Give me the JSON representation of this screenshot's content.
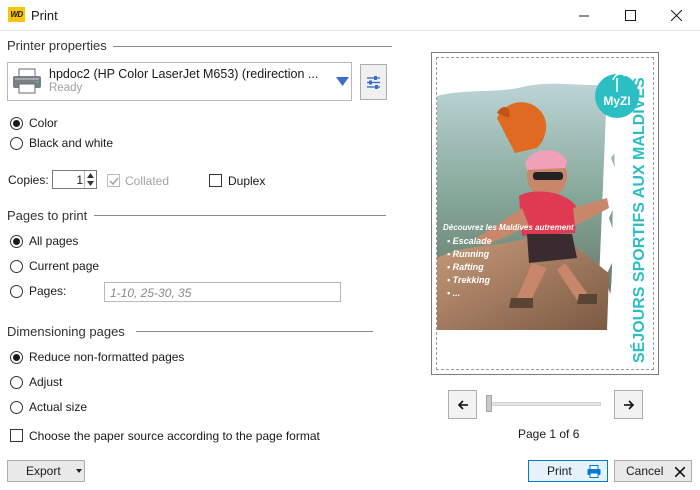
{
  "window": {
    "title": "Print",
    "logo_text": "WD"
  },
  "printer_properties": {
    "header": "Printer properties",
    "printer_name": "hpdoc2 (HP Color LaserJet M653) (redirection ...",
    "printer_status": "Ready"
  },
  "color_options": {
    "color_label": "Color",
    "bw_label": "Black and white",
    "selected": "Color"
  },
  "copies": {
    "label": "Copies:",
    "value": "1",
    "collated_label": "Collated",
    "duplex_label": "Duplex"
  },
  "pages_to_print": {
    "header": "Pages to print",
    "all_label": "All pages",
    "current_label": "Current page",
    "pages_label": "Pages:",
    "pages_placeholder": "1-10, 25-30, 35",
    "selected": "All pages"
  },
  "dimensioning": {
    "header": "Dimensioning pages",
    "reduce_label": "Reduce non-formatted pages",
    "adjust_label": "Adjust",
    "actual_label": "Actual size",
    "selected": "Reduce non-formatted pages"
  },
  "paper_source": {
    "label": "Choose the paper source according to the page format"
  },
  "preview": {
    "logo_text": "MyZI",
    "vertical_text": "SÉJOURS SPORTIFS AUX MALDIVES",
    "tagline": "Découvrez les Maldives autrement",
    "activities": [
      "Escalade",
      "Running",
      "Rafting",
      "Trekking",
      "..."
    ],
    "page_label": "Page 1 of 6"
  },
  "buttons": {
    "export_label": "Export",
    "print_label": "Print",
    "cancel_label": "Cancel"
  },
  "colors": {
    "accent": "#0078d7",
    "combo_arrow": "#3c6fc4",
    "brand_teal": "#2bbfc4"
  }
}
